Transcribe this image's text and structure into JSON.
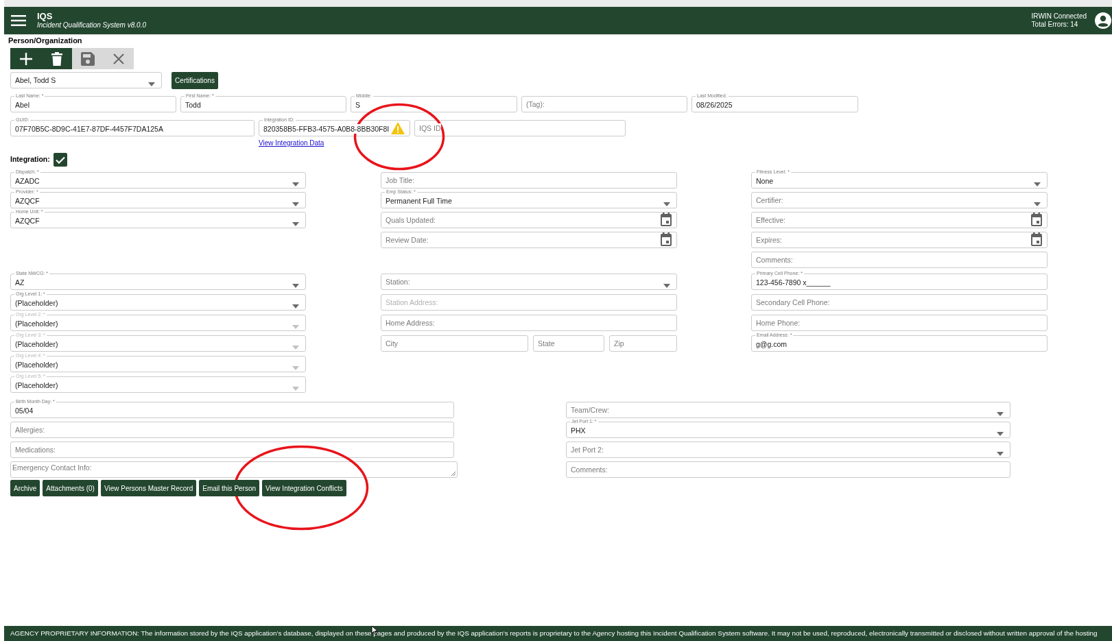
{
  "header": {
    "app_name": "IQS",
    "subtitle": "Incident Qualification System v8.0.0",
    "connection": "IRWIN Connected",
    "errors": "Total Errors: 14"
  },
  "page_title": "Person/Organization",
  "toolbar": [
    {
      "kind": "add",
      "disabled": false
    },
    {
      "kind": "delete",
      "disabled": false
    },
    {
      "kind": "save",
      "disabled": true
    },
    {
      "kind": "cancel",
      "disabled": true
    }
  ],
  "person_select": {
    "kind": "select",
    "value": "Abel, Todd S"
  },
  "certifications_button": "Certifications",
  "name_row": [
    {
      "kind": "text",
      "label": "Last Name: *",
      "value": "Abel"
    },
    {
      "kind": "text",
      "label": "First Name: *",
      "value": "Todd"
    },
    {
      "kind": "text",
      "label": "Middle:",
      "value": "S"
    },
    {
      "kind": "text",
      "placeholder": "(Tag):"
    },
    {
      "kind": "text",
      "label": "Last Modified:",
      "value": "08/26/2025"
    }
  ],
  "id_row": [
    {
      "kind": "text",
      "label": "GUID:",
      "value": "07F70B5C-8D9C-41E7-87DF-4457F7DA125A",
      "warning": false
    },
    {
      "kind": "text",
      "label": "Integration ID:",
      "value": "820358B5-FFB3-4575-A0B8-8BB30F8I",
      "warning": true
    },
    {
      "kind": "text",
      "placeholder": "IQS ID",
      "warning": false
    }
  ],
  "integration_link": "View Integration Data",
  "integration": {
    "label": "Integration:",
    "checked": true
  },
  "column_1_top": [
    {
      "kind": "select",
      "label": "Dispatch: *",
      "value": "AZADC"
    },
    {
      "kind": "select",
      "label": "Provider: *",
      "value": "AZQCF"
    },
    {
      "kind": "select",
      "label": "Home Unit: *",
      "value": "AZQCF"
    }
  ],
  "column_2_top": [
    {
      "kind": "text",
      "placeholder": "Job Title:"
    },
    {
      "kind": "select",
      "label": "Emp Status: *",
      "value": "Permanent Full Time"
    },
    {
      "kind": "date",
      "placeholder": "Quals Updated:"
    },
    {
      "kind": "date",
      "placeholder": "Review Date:"
    }
  ],
  "column_3_top": [
    {
      "kind": "select",
      "label": "Fitness Level: *",
      "value": "None"
    },
    {
      "kind": "select",
      "placeholder": "Certifier:"
    },
    {
      "kind": "date",
      "placeholder": "Effective:"
    },
    {
      "kind": "date",
      "placeholder": "Expires:"
    },
    {
      "kind": "text",
      "placeholder": "Comments:"
    }
  ],
  "column_1_bottom": [
    {
      "kind": "select",
      "label": "State NWCG: *",
      "value": "AZ",
      "disabled": false
    },
    {
      "kind": "select",
      "label": "Org Level 1: *",
      "value": "(Placeholder)",
      "disabled": false
    },
    {
      "kind": "select",
      "label": "Org Level 2: *",
      "value": "(Placeholder)",
      "disabled": true
    },
    {
      "kind": "select",
      "label": "Org Level 3: *",
      "value": "(Placeholder)",
      "disabled": true
    },
    {
      "kind": "select",
      "label": "Org Level 4: *",
      "value": "(Placeholder)",
      "disabled": true
    },
    {
      "kind": "select",
      "label": "Org Level 5: *",
      "value": "(Placeholder)",
      "disabled": true
    }
  ],
  "column_2_bottom": [
    {
      "kind": "select",
      "placeholder": "Station:",
      "disabled": false
    },
    {
      "kind": "text",
      "placeholder": "Station Address:",
      "disabled": true
    },
    {
      "kind": "text",
      "placeholder": "Home Address:",
      "disabled": false
    },
    {
      "kind": "group",
      "disabled": false,
      "fields": [
        {
          "kind": "text",
          "placeholder": "City"
        },
        {
          "kind": "text",
          "placeholder": "State"
        },
        {
          "kind": "text",
          "placeholder": "Zip"
        }
      ]
    }
  ],
  "column_3_bottom": [
    {
      "kind": "text",
      "label": "Primary Cell Phone: *",
      "value": "123-456-7890 x______"
    },
    {
      "kind": "text",
      "placeholder": "Secondary Cell Phone:"
    },
    {
      "kind": "text",
      "placeholder": "Home Phone:"
    },
    {
      "kind": "text",
      "label": "Email Address: *",
      "value": "g@g.com"
    }
  ],
  "personal": [
    {
      "kind": "text",
      "label": "Birth Month Day: *",
      "value": "05/04"
    },
    {
      "kind": "text",
      "placeholder": "Allergies:"
    },
    {
      "kind": "text",
      "placeholder": "Medications:"
    },
    {
      "kind": "textarea",
      "placeholder": "Emergency Contact Info:"
    }
  ],
  "travel": [
    {
      "kind": "select",
      "placeholder": "Team/Crew:"
    },
    {
      "kind": "select",
      "label": "Jet Port 1: *",
      "value": "PHX"
    },
    {
      "kind": "select",
      "placeholder": "Jet Port 2:"
    },
    {
      "kind": "text",
      "placeholder": "Comments:"
    }
  ],
  "actions": [
    "Archive",
    "Attachments (0)",
    "View Persons Master Record",
    "Email this Person",
    "View Integration Conflicts"
  ],
  "footer": "AGENCY PROPRIETARY INFORMATION: The information stored by the IQS application's database, displayed on these pages and produced by the IQS application's reports is proprietary to the Agency hosting this Incident Qualification System software. It may not be used, reproduced, electronically transmitted or disclosed without written approval of the hosting"
}
